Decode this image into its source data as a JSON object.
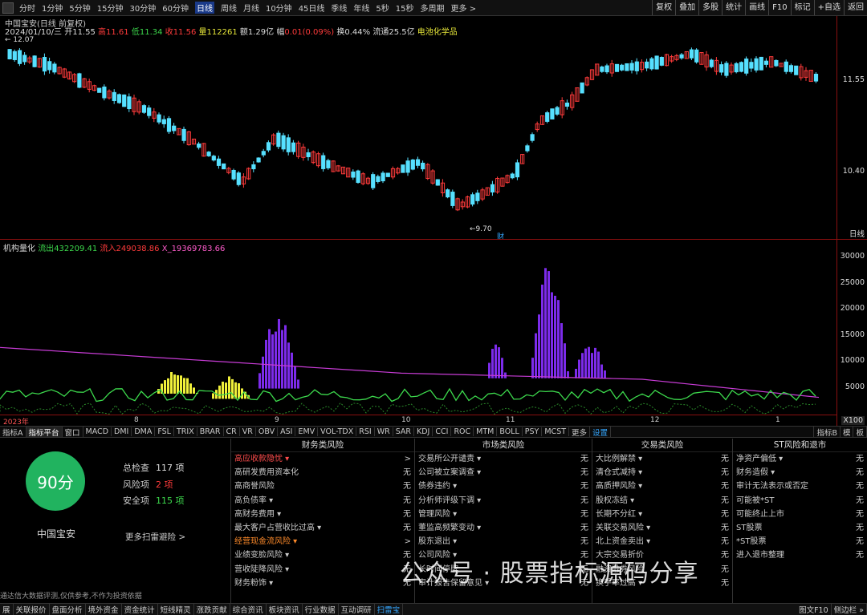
{
  "toolbar": {
    "periods": [
      "分时",
      "1分钟",
      "5分钟",
      "15分钟",
      "30分钟",
      "60分钟",
      "日线",
      "周线",
      "月线",
      "10分钟",
      "45日线",
      "季线",
      "年线",
      "5秒",
      "15秒",
      "多周期",
      "更多 >"
    ],
    "active_period": "日线",
    "right_buttons": [
      "复权",
      "叠加",
      "多股",
      "统计",
      "画线",
      "F10",
      "标记",
      "+自选",
      "返回"
    ]
  },
  "stock": {
    "title": "中国宝安(日线 前复权)",
    "date": "2024/01/10/三",
    "open_label": "开",
    "open": "11.55",
    "high_label": "高",
    "high": "11.61",
    "low_label": "低",
    "low": "11.34",
    "close_label": "收",
    "close": "11.56",
    "volume_label": "量",
    "volume": "112261",
    "amount_label": "额",
    "amount": "1.29亿",
    "change_label": "幅",
    "change": "0.01(0.09%)",
    "turnover_label": "换",
    "turnover": "0.44%",
    "float_label": "流通",
    "float_value": "25.5亿",
    "sector": "电池化学品"
  },
  "price_axis": {
    "ticks": [
      "11.55",
      "10.40"
    ],
    "top_price": "12.07",
    "low_price": "9.70",
    "period_label": "日线",
    "event_marker": "财"
  },
  "indicator": {
    "name": "机构量化",
    "outflow_label": "流出",
    "outflow": "432209.41",
    "inflow_label": "流入",
    "inflow": "249038.86",
    "x19_label": "X_19",
    "x19": "369783.66",
    "ticks": [
      "30000",
      "25000",
      "20000",
      "15000",
      "10000",
      "5000"
    ],
    "scale": "X100"
  },
  "xaxis": {
    "labels": [
      "2023年",
      "8",
      "9",
      "10",
      "11",
      "12",
      "1"
    ]
  },
  "tabs": [
    "指标A",
    "指标平台",
    "窗口",
    "MACD",
    "DMI",
    "DMA",
    "FSL",
    "TRIX",
    "BRAR",
    "CR",
    "VR",
    "OBV",
    "ASI",
    "EMV",
    "VOL-TDX",
    "RSI",
    "WR",
    "SAR",
    "KDJ",
    "CCI",
    "ROC",
    "MTM",
    "BOLL",
    "PSY",
    "MCST",
    "更多",
    "设置"
  ],
  "tabs_right": [
    "指标B",
    "模",
    "板"
  ],
  "scan": {
    "score": "90分",
    "name": "中国宝安",
    "total_label": "总检查",
    "total": "117 项",
    "risk_label": "风险项",
    "risk": "2 项",
    "safe_label": "安全项",
    "safe": "115 项",
    "more": "更多扫雷避险 >"
  },
  "risk_columns": [
    {
      "title": "财务类风险",
      "rows": [
        {
          "name": "高应收款隐忧 ▾",
          "value": ">",
          "style": "r"
        },
        {
          "name": "高研发费用资本化",
          "value": "无",
          "style": ""
        },
        {
          "name": "高商誉风险",
          "value": "无",
          "style": ""
        },
        {
          "name": "高负债率 ▾",
          "value": "无",
          "style": ""
        },
        {
          "name": "高财务费用 ▾",
          "value": "无",
          "style": ""
        },
        {
          "name": "最大客户占营收比过高 ▾",
          "value": "无",
          "style": ""
        },
        {
          "name": "经营现金流风险 ▾",
          "value": ">",
          "style": "o"
        },
        {
          "name": "业绩变脸风险 ▾",
          "value": "无",
          "style": ""
        },
        {
          "name": "营收陡降风险 ▾",
          "value": "无",
          "style": ""
        },
        {
          "name": "财务粉饰 ▾",
          "value": "无",
          "style": ""
        }
      ]
    },
    {
      "title": "市场类风险",
      "rows": [
        {
          "name": "交易所公开谴责 ▾",
          "value": "无",
          "style": ""
        },
        {
          "name": "公司被立案调查 ▾",
          "value": "无",
          "style": ""
        },
        {
          "name": "债券违约 ▾",
          "value": "无",
          "style": ""
        },
        {
          "name": "分析师评级下调 ▾",
          "value": "无",
          "style": ""
        },
        {
          "name": "管理风险 ▾",
          "value": "无",
          "style": ""
        },
        {
          "name": "董监高频繁变动 ▾",
          "value": "无",
          "style": ""
        },
        {
          "name": "股东退出 ▾",
          "value": "无",
          "style": ""
        },
        {
          "name": "公司风险 ▾",
          "value": "无",
          "style": ""
        },
        {
          "name": "长时间停牌",
          "value": "无",
          "style": ""
        },
        {
          "name": "审计报告保留意见 ▾",
          "value": "无",
          "style": ""
        }
      ]
    },
    {
      "title": "交易类风险",
      "rows": [
        {
          "name": "大比例解禁 ▾",
          "value": "无",
          "style": ""
        },
        {
          "name": "清仓式减持 ▾",
          "value": "无",
          "style": ""
        },
        {
          "name": "高质押风险 ▾",
          "value": "无",
          "style": ""
        },
        {
          "name": "股权冻结 ▾",
          "value": "无",
          "style": ""
        },
        {
          "name": "长期不分红 ▾",
          "value": "无",
          "style": ""
        },
        {
          "name": "关联交易风险 ▾",
          "value": "无",
          "style": ""
        },
        {
          "name": "北上资金卖出 ▾",
          "value": "无",
          "style": ""
        },
        {
          "name": "大宗交易折价",
          "value": "无",
          "style": ""
        },
        {
          "name": "融资融券风险",
          "value": "无",
          "style": ""
        },
        {
          "name": "换手率过高 ▾",
          "value": "无",
          "style": ""
        }
      ]
    },
    {
      "title": "ST风险和退市",
      "rows": [
        {
          "name": "净资产偏低 ▾",
          "value": "无",
          "style": ""
        },
        {
          "name": "财务造假 ▾",
          "value": "无",
          "style": ""
        },
        {
          "name": "审计无法表示或否定",
          "value": "无",
          "style": ""
        },
        {
          "name": "可能被*ST",
          "value": "无",
          "style": ""
        },
        {
          "name": "可能终止上市",
          "value": "无",
          "style": ""
        },
        {
          "name": "ST股票",
          "value": "无",
          "style": ""
        },
        {
          "name": "*ST股票",
          "value": "无",
          "style": ""
        },
        {
          "name": "进入退市整理",
          "value": "无",
          "style": ""
        }
      ]
    }
  ],
  "watermark": "公众号 · 股票指标源码分享",
  "disclaimer": "通达信大数据评测,仅供参考,不作为投资依据",
  "statusbar": [
    "展",
    "关联报价",
    "盘面分析",
    "境外资金",
    "资金统计",
    "短线精灵",
    "涨跌贡献",
    "综合资讯",
    "板块资讯",
    "行业数据",
    "互动调研",
    "扫雷宝"
  ],
  "statusbar_right": [
    "图文F10",
    "侧边栏 »"
  ],
  "colors": {
    "up": "#ff3b3b",
    "down": "#56e0ff",
    "accent": "#1a3a8a",
    "score": "#21b35f",
    "bar_purple": "#7c2bea",
    "bar_yellow": "#f0f03a"
  }
}
